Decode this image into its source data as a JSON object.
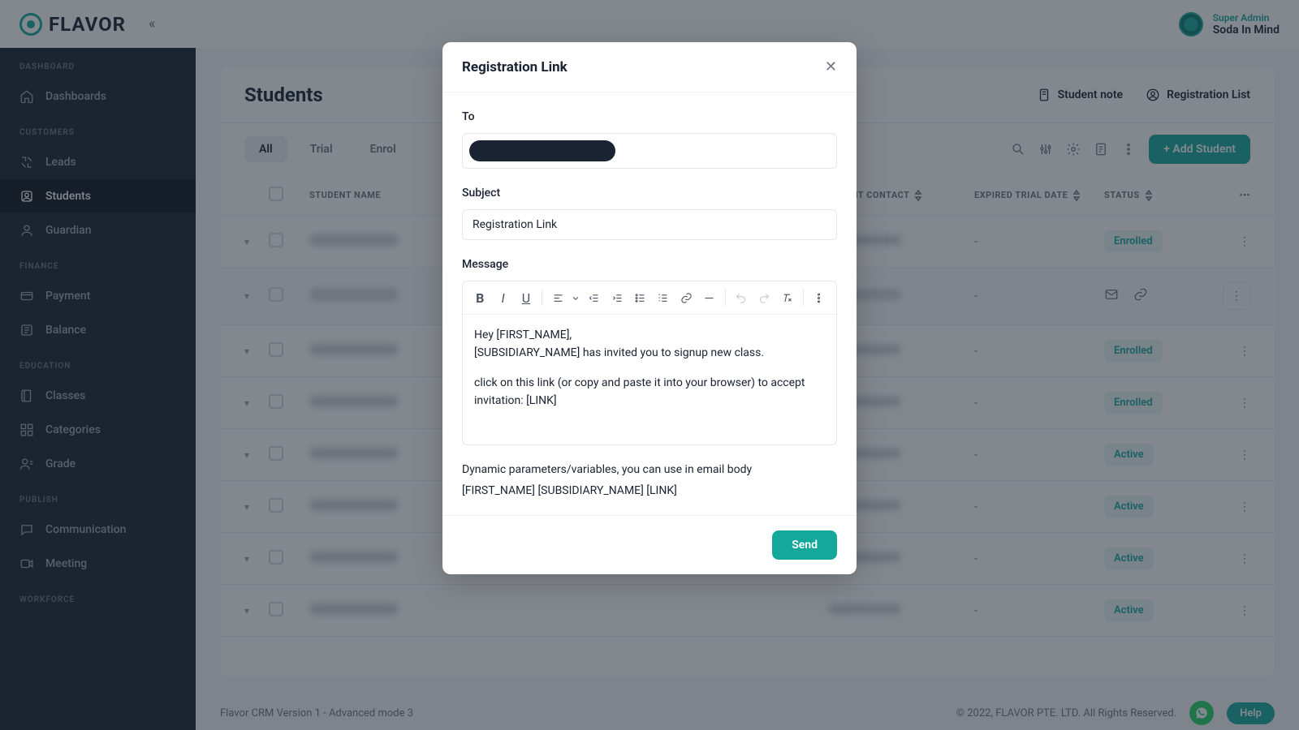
{
  "brand": {
    "name": "FLAVOR"
  },
  "user": {
    "role": "Super Admin",
    "name": "Soda In Mind"
  },
  "sidebar": {
    "sections": [
      {
        "label": "DASHBOARD",
        "items": [
          {
            "label": "Dashboards",
            "icon": "home-icon"
          }
        ]
      },
      {
        "label": "CUSTOMERS",
        "items": [
          {
            "label": "Leads",
            "icon": "leads-icon"
          },
          {
            "label": "Students",
            "icon": "students-icon",
            "active": true
          },
          {
            "label": "Guardian",
            "icon": "guardian-icon"
          }
        ]
      },
      {
        "label": "FINANCE",
        "items": [
          {
            "label": "Payment",
            "icon": "card-icon"
          },
          {
            "label": "Balance",
            "icon": "balance-icon"
          }
        ]
      },
      {
        "label": "EDUCATION",
        "items": [
          {
            "label": "Classes",
            "icon": "book-icon"
          },
          {
            "label": "Categories",
            "icon": "categories-icon"
          },
          {
            "label": "Grade",
            "icon": "grade-icon"
          }
        ]
      },
      {
        "label": "PUBLISH",
        "items": [
          {
            "label": "Communication",
            "icon": "chat-icon"
          },
          {
            "label": "Meeting",
            "icon": "meeting-icon"
          }
        ]
      },
      {
        "label": "WORKFORCE",
        "items": []
      }
    ]
  },
  "page": {
    "title": "Students",
    "actions": {
      "note": "Student note",
      "reglist": "Registration List"
    },
    "tabs": [
      "All",
      "Trial",
      "Enrol"
    ],
    "active_tab": 0,
    "add_button": "+ Add Student",
    "columns": {
      "name": "STUDENT NAME",
      "contact": "PARENT CONTACT",
      "date": "EXPIRED TRIAL DATE",
      "status": "STATUS"
    },
    "rows": [
      {
        "date": "-",
        "status": "Enrolled"
      },
      {
        "date": "-",
        "status": "",
        "hover": true
      },
      {
        "date": "-",
        "status": "Enrolled"
      },
      {
        "date": "-",
        "status": "Enrolled"
      },
      {
        "date": "-",
        "status": "Active"
      },
      {
        "date": "-",
        "status": "Active"
      },
      {
        "date": "-",
        "status": "Active"
      },
      {
        "date": "-",
        "status": "Active"
      }
    ]
  },
  "footer": {
    "version": "Flavor CRM Version 1 - Advanced mode 3",
    "copyright": "© 2022, FLAVOR PTE. LTD. All Rights Reserved.",
    "help": "Help"
  },
  "modal": {
    "title": "Registration Link",
    "to_label": "To",
    "subject_label": "Subject",
    "subject_value": "Registration Link",
    "message_label": "Message",
    "message_body_line1": "Hey [FIRST_NAME],",
    "message_body_line2": "[SUBSIDIARY_NAME] has invited you to signup new class.",
    "message_body_line3": "click on this link (or copy and paste it into your browser) to accept invitation: [LINK]",
    "dyn_label": "Dynamic parameters/variables, you can use in email body",
    "dyn_vars": "[FIRST_NAME] [SUBSIDIARY_NAME] [LINK]",
    "send": "Send"
  }
}
